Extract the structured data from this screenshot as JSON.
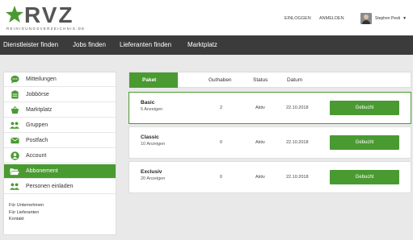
{
  "logo": {
    "text": "RVZ",
    "subtitle": "REINIGUNGSVERZEICHNIS.DE"
  },
  "header": {
    "login": "EINLOGGEN",
    "register": "ANMELDEN",
    "user_name": "Stephen Pesti",
    "caret": "▼"
  },
  "nav": {
    "items": [
      "Dienstleister finden",
      "Jobs finden",
      "Lieferanten finden",
      "Marktplatz"
    ]
  },
  "sidebar": {
    "items": [
      {
        "label": "Mitteilungen",
        "icon": "chat-icon"
      },
      {
        "label": "Jobbörse",
        "icon": "clipboard-icon"
      },
      {
        "label": "Marktplatz",
        "icon": "basket-icon"
      },
      {
        "label": "Gruppen",
        "icon": "group-icon"
      },
      {
        "label": "Postfach",
        "icon": "mail-icon"
      },
      {
        "label": "Account",
        "icon": "user-icon"
      },
      {
        "label": "Abbonement",
        "icon": "folder-icon",
        "active": true
      },
      {
        "label": "Personen einladen",
        "icon": "invite-icon"
      }
    ],
    "links": [
      "Für Unternehmen",
      "Für Lieferanten",
      "Kontakt"
    ]
  },
  "table": {
    "headers": {
      "paket": "Paket",
      "guthaben": "Guthaben",
      "status": "Status",
      "datum": "Datum"
    }
  },
  "packages": [
    {
      "name": "Basic",
      "sub": "5 Anzeigen",
      "guthaben": "2",
      "status": "Aktiv",
      "datum": "22.10.2018",
      "button": "Gebucht",
      "selected": true
    },
    {
      "name": "Classic",
      "sub": "10 Anzeigen",
      "guthaben": "0",
      "status": "Aktiv",
      "datum": "22.10.2018",
      "button": "Gebucht"
    },
    {
      "name": "Exclusiv",
      "sub": "20 Anzeigen",
      "guthaben": "0",
      "status": "Aktiv",
      "datum": "22.10.2018",
      "button": "Gebucht"
    }
  ],
  "colors": {
    "accent": "#4a9a32",
    "nav_bg": "#3b3b3b",
    "page_bg": "#e9e9e9"
  }
}
